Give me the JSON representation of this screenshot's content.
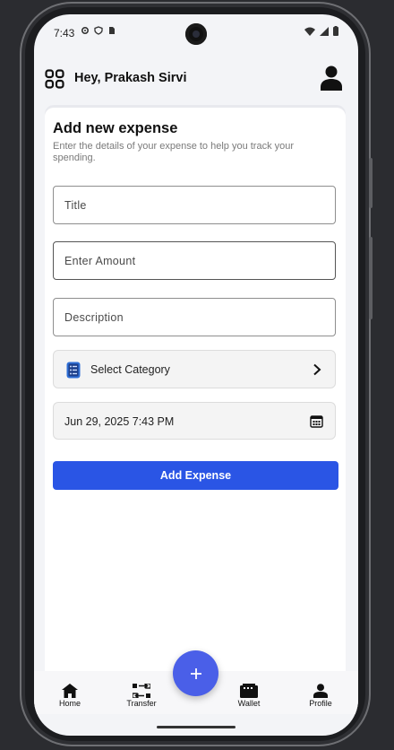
{
  "status_bar": {
    "time": "7:43"
  },
  "app_bar": {
    "greeting": "Hey, Prakash Sirvi"
  },
  "form": {
    "heading": "Add new expense",
    "subtitle": "Enter the details of your expense to help you track your spending.",
    "title_field": {
      "placeholder": "Title",
      "value": ""
    },
    "amount_field": {
      "placeholder": "Enter Amount",
      "value": ""
    },
    "description_field": {
      "placeholder": "Description",
      "value": ""
    },
    "category": {
      "label": "Select Category"
    },
    "date_time": {
      "value": "Jun 29, 2025 7:43 PM"
    },
    "submit_label": "Add Expense"
  },
  "colors": {
    "primary": "#2a55e5",
    "fab": "#4a5fe8",
    "category_icon": "#2f6fd6"
  },
  "bottom_nav": {
    "items": [
      {
        "label": "Home",
        "icon": "home-icon"
      },
      {
        "label": "Transfer",
        "icon": "transfer-icon"
      },
      {
        "label": "Wallet",
        "icon": "wallet-icon"
      },
      {
        "label": "Profile",
        "icon": "profile-icon"
      }
    ],
    "fab_icon": "plus-icon"
  }
}
